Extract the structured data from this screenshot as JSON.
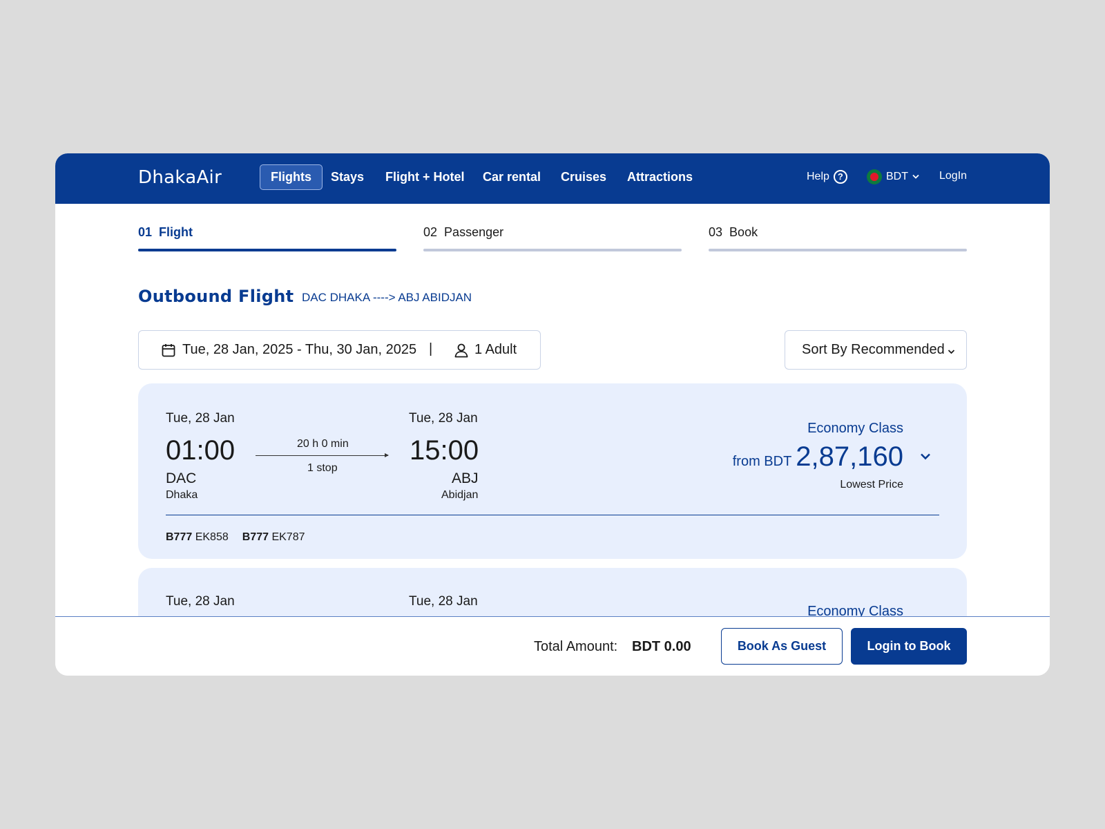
{
  "brand": {
    "logo": "DhakaAir"
  },
  "nav": {
    "items": [
      {
        "label": "Flights",
        "active": true
      },
      {
        "label": "Stays"
      },
      {
        "label": "Flight + Hotel"
      },
      {
        "label": "Car rental"
      },
      {
        "label": "Cruises"
      },
      {
        "label": "Attractions"
      }
    ],
    "help": "Help",
    "currency": "BDT",
    "login": "LogIn"
  },
  "steps": [
    {
      "num": "01",
      "label": "Flight",
      "active": true
    },
    {
      "num": "02",
      "label": "Passenger"
    },
    {
      "num": "03",
      "label": "Book"
    }
  ],
  "outbound": {
    "title": "Outbound Flight",
    "route": "DAC DHAKA ----> ABJ ABIDJAN"
  },
  "search": {
    "dates": "Tue, 28 Jan, 2025 - Thu, 30 Jan, 2025",
    "separator": "|",
    "passengers": "1 Adult",
    "sort": "Sort By Recommended"
  },
  "flights": [
    {
      "dep_date": "Tue, 28 Jan",
      "dep_time": "01:00",
      "dep_code": "DAC",
      "dep_city": "Dhaka",
      "duration": "20 h 0 min",
      "stops": "1 stop",
      "arr_date": "Tue, 28 Jan",
      "arr_time": "15:00",
      "arr_code": "ABJ",
      "arr_city": "Abidjan",
      "class": "Economy Class",
      "price_prefix": "from BDT",
      "price": "2,87,160",
      "price_note": "Lowest Price",
      "legs": [
        {
          "aircraft": "B777",
          "flight": "EK858"
        },
        {
          "aircraft": "B777",
          "flight": "EK787"
        }
      ]
    },
    {
      "dep_date": "Tue, 28 Jan",
      "arr_date": "Tue, 28 Jan",
      "class": "Economy Class"
    }
  ],
  "footer": {
    "total_label": "Total Amount:",
    "total_value": "BDT 0.00",
    "guest_button": "Book As Guest",
    "login_button": "Login to Book"
  },
  "colors": {
    "brand": "#083b91",
    "card": "#e8effd",
    "background": "#dcdcdc"
  }
}
